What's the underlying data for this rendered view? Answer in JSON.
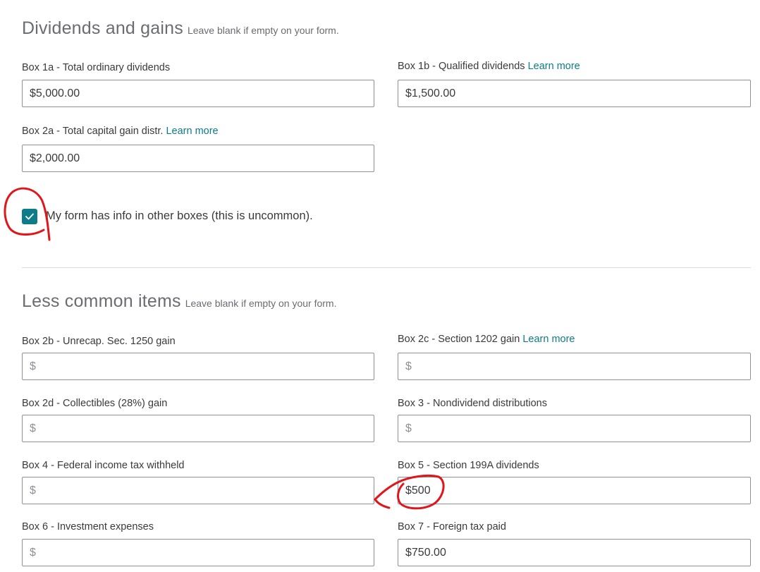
{
  "dividends_section": {
    "title": "Dividends and gains",
    "hint": "Leave blank if empty on your form.",
    "fields": {
      "box1a": {
        "label": "Box 1a - Total ordinary dividends",
        "value": "$5,000.00",
        "placeholder": "$"
      },
      "box1b": {
        "label": "Box 1b - Qualified dividends",
        "link": "Learn more",
        "value": "$1,500.00",
        "placeholder": "$"
      },
      "box2a": {
        "label": "Box 2a - Total capital gain distr.",
        "link": "Learn more",
        "value": "$2,000.00",
        "placeholder": "$"
      }
    }
  },
  "other_boxes": {
    "label": "My form has info in other boxes (this is uncommon).",
    "checked": true
  },
  "less_common_section": {
    "title": "Less common items",
    "hint": "Leave blank if empty on your form.",
    "fields": {
      "box2b": {
        "label": "Box 2b - Unrecap. Sec. 1250 gain",
        "value": "",
        "placeholder": "$"
      },
      "box2c": {
        "label": "Box 2c - Section 1202 gain",
        "link": "Learn more",
        "value": "",
        "placeholder": "$"
      },
      "box2d": {
        "label": "Box 2d - Collectibles (28%) gain",
        "value": "",
        "placeholder": "$"
      },
      "box3": {
        "label": "Box 3 - Nondividend distributions",
        "value": "",
        "placeholder": "$"
      },
      "box4": {
        "label": "Box 4 - Federal income tax withheld",
        "value": "",
        "placeholder": "$"
      },
      "box5": {
        "label": "Box 5 - Section 199A dividends",
        "value": "$500",
        "placeholder": "$"
      },
      "box6": {
        "label": "Box 6 - Investment expenses",
        "value": "",
        "placeholder": "$"
      },
      "box7": {
        "label": "Box 7 - Foreign tax paid",
        "value": "$750.00",
        "placeholder": "$"
      }
    }
  },
  "colors": {
    "link": "#0d7c89",
    "checkbox": "#0d7c89",
    "annotation": "#e0161b",
    "input_border": "#8d9096"
  }
}
